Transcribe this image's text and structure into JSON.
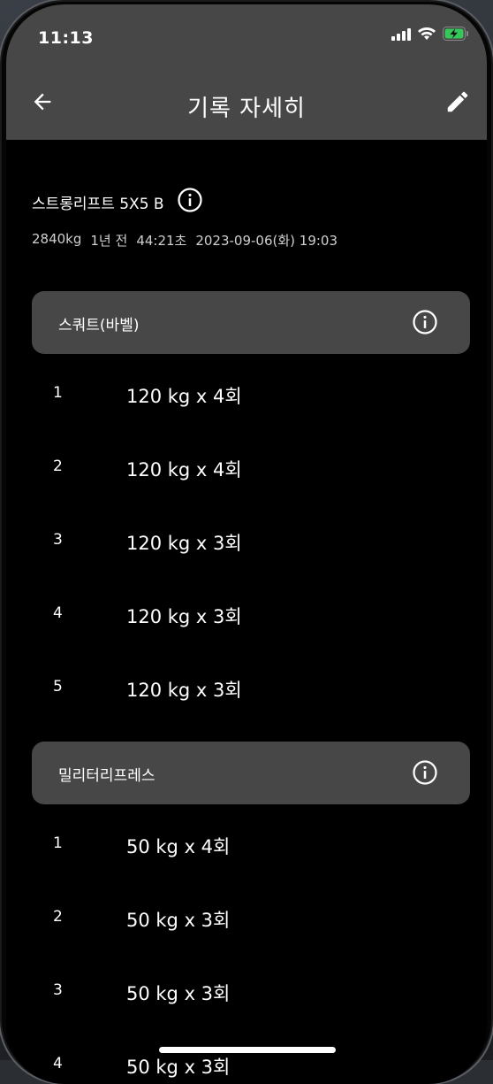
{
  "status_bar": {
    "time": "11:13"
  },
  "app_bar": {
    "title": "기록 자세히"
  },
  "routine": {
    "name": "스트롱리프트 5X5 B",
    "meta": [
      "2840kg",
      "1년 전",
      "44:21초",
      "2023-09-06(화) 19:03"
    ]
  },
  "exercises": [
    {
      "name": "스쿼트(바벨)",
      "sets": [
        {
          "num": "1",
          "value": "120 kg x 4회"
        },
        {
          "num": "2",
          "value": "120 kg x 4회"
        },
        {
          "num": "3",
          "value": "120 kg x 3회"
        },
        {
          "num": "4",
          "value": "120 kg x 3회"
        },
        {
          "num": "5",
          "value": "120 kg x 3회"
        }
      ]
    },
    {
      "name": "밀리터리프레스",
      "sets": [
        {
          "num": "1",
          "value": "50 kg x 4회"
        },
        {
          "num": "2",
          "value": "50 kg x 3회"
        },
        {
          "num": "3",
          "value": "50 kg x 3회"
        },
        {
          "num": "4",
          "value": "50 kg x 3회"
        }
      ]
    }
  ],
  "icons": {
    "back": "arrow-left-icon",
    "edit": "pencil-icon",
    "info": "info-circle-icon"
  },
  "colors": {
    "app_bar": "#474747",
    "background": "#000000",
    "card": "#474747",
    "text": "#ffffff"
  }
}
